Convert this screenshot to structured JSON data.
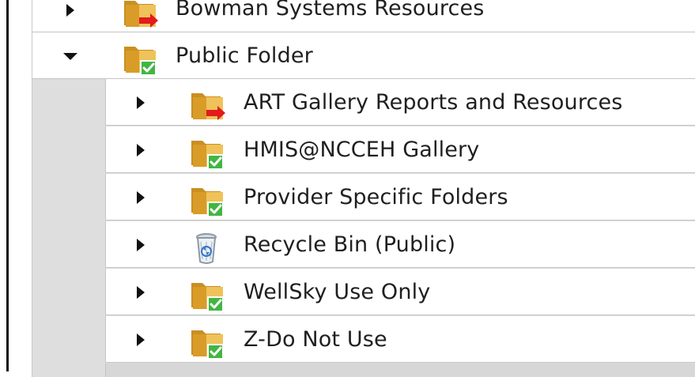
{
  "tree": {
    "root_partial": {
      "label": "Bowman Systems Resources",
      "icon": "folder-arrow-icon"
    },
    "public_folder": {
      "label": "Public Folder",
      "icon": "folder-check-icon",
      "expanded": true
    },
    "children": [
      {
        "label": "ART Gallery Reports and Resources",
        "icon": "folder-arrow-icon"
      },
      {
        "label": "HMIS@NCCEH Gallery",
        "icon": "folder-check-icon"
      },
      {
        "label": "Provider Specific Folders",
        "icon": "folder-check-icon"
      },
      {
        "label": "Recycle Bin (Public)",
        "icon": "recycle-bin-icon"
      },
      {
        "label": "WellSky Use Only",
        "icon": "folder-check-icon"
      },
      {
        "label": "Z-Do Not Use",
        "icon": "folder-check-icon"
      }
    ]
  },
  "colors": {
    "folder_yellow": "#e8b84a",
    "folder_shadow": "#c88f20",
    "check_green": "#41b641",
    "arrow_red": "#e21b1b",
    "child_background": "#dedede",
    "row_border": "#c4c4c4"
  }
}
